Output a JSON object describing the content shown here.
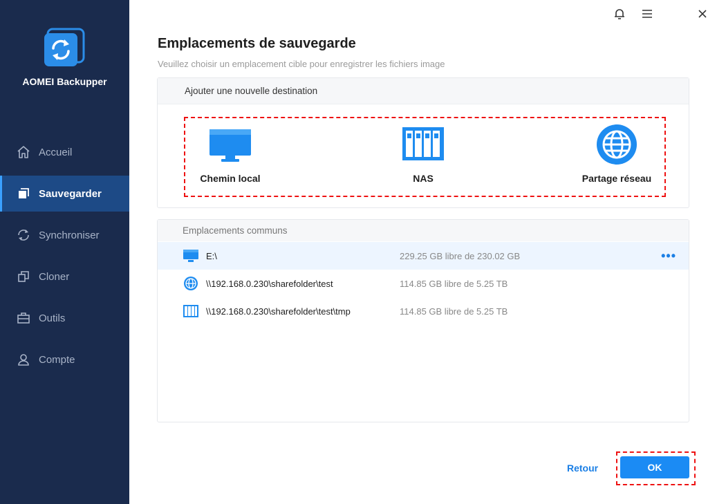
{
  "app": {
    "name": "AOMEI Backupper"
  },
  "sidebar": {
    "items": [
      {
        "label": "Accueil",
        "icon": "home-icon",
        "active": false
      },
      {
        "label": "Sauvegarder",
        "icon": "backup-icon",
        "active": true
      },
      {
        "label": "Synchroniser",
        "icon": "sync-icon",
        "active": false
      },
      {
        "label": "Cloner",
        "icon": "clone-icon",
        "active": false
      },
      {
        "label": "Outils",
        "icon": "tools-icon",
        "active": false
      },
      {
        "label": "Compte",
        "icon": "user-icon",
        "active": false
      }
    ]
  },
  "header": {
    "icons": [
      "bell-icon",
      "menu-icon",
      "close-icon"
    ]
  },
  "main": {
    "title": "Emplacements de sauvegarde",
    "subtitle": "Veuillez choisir un emplacement cible pour enregistrer les fichiers image",
    "add_destination": {
      "header": "Ajouter une nouvelle destination",
      "options": [
        {
          "label": "Chemin local",
          "icon": "monitor-icon"
        },
        {
          "label": "NAS",
          "icon": "nas-icon"
        },
        {
          "label": "Partage réseau",
          "icon": "globe-icon"
        }
      ]
    },
    "common": {
      "header": "Emplacements communs",
      "rows": [
        {
          "path": "E:\\",
          "free": "229.25 GB libre de 230.02 GB",
          "icon": "monitor-icon",
          "selected": true,
          "more": "•••"
        },
        {
          "path": "\\\\192.168.0.230\\sharefolder\\test",
          "free": "114.85 GB libre de 5.25 TB",
          "icon": "globe-icon",
          "selected": false
        },
        {
          "path": "\\\\192.168.0.230\\sharefolder\\test\\tmp",
          "free": "114.85 GB libre de 5.25 TB",
          "icon": "nas-icon",
          "selected": false
        }
      ]
    }
  },
  "footer": {
    "back_label": "Retour",
    "ok_label": "OK"
  },
  "colors": {
    "sidebar_bg": "#1a2b4d",
    "active_bg": "#1d4a86",
    "accent": "#1b8bf4",
    "highlight_border": "#ee1111"
  }
}
